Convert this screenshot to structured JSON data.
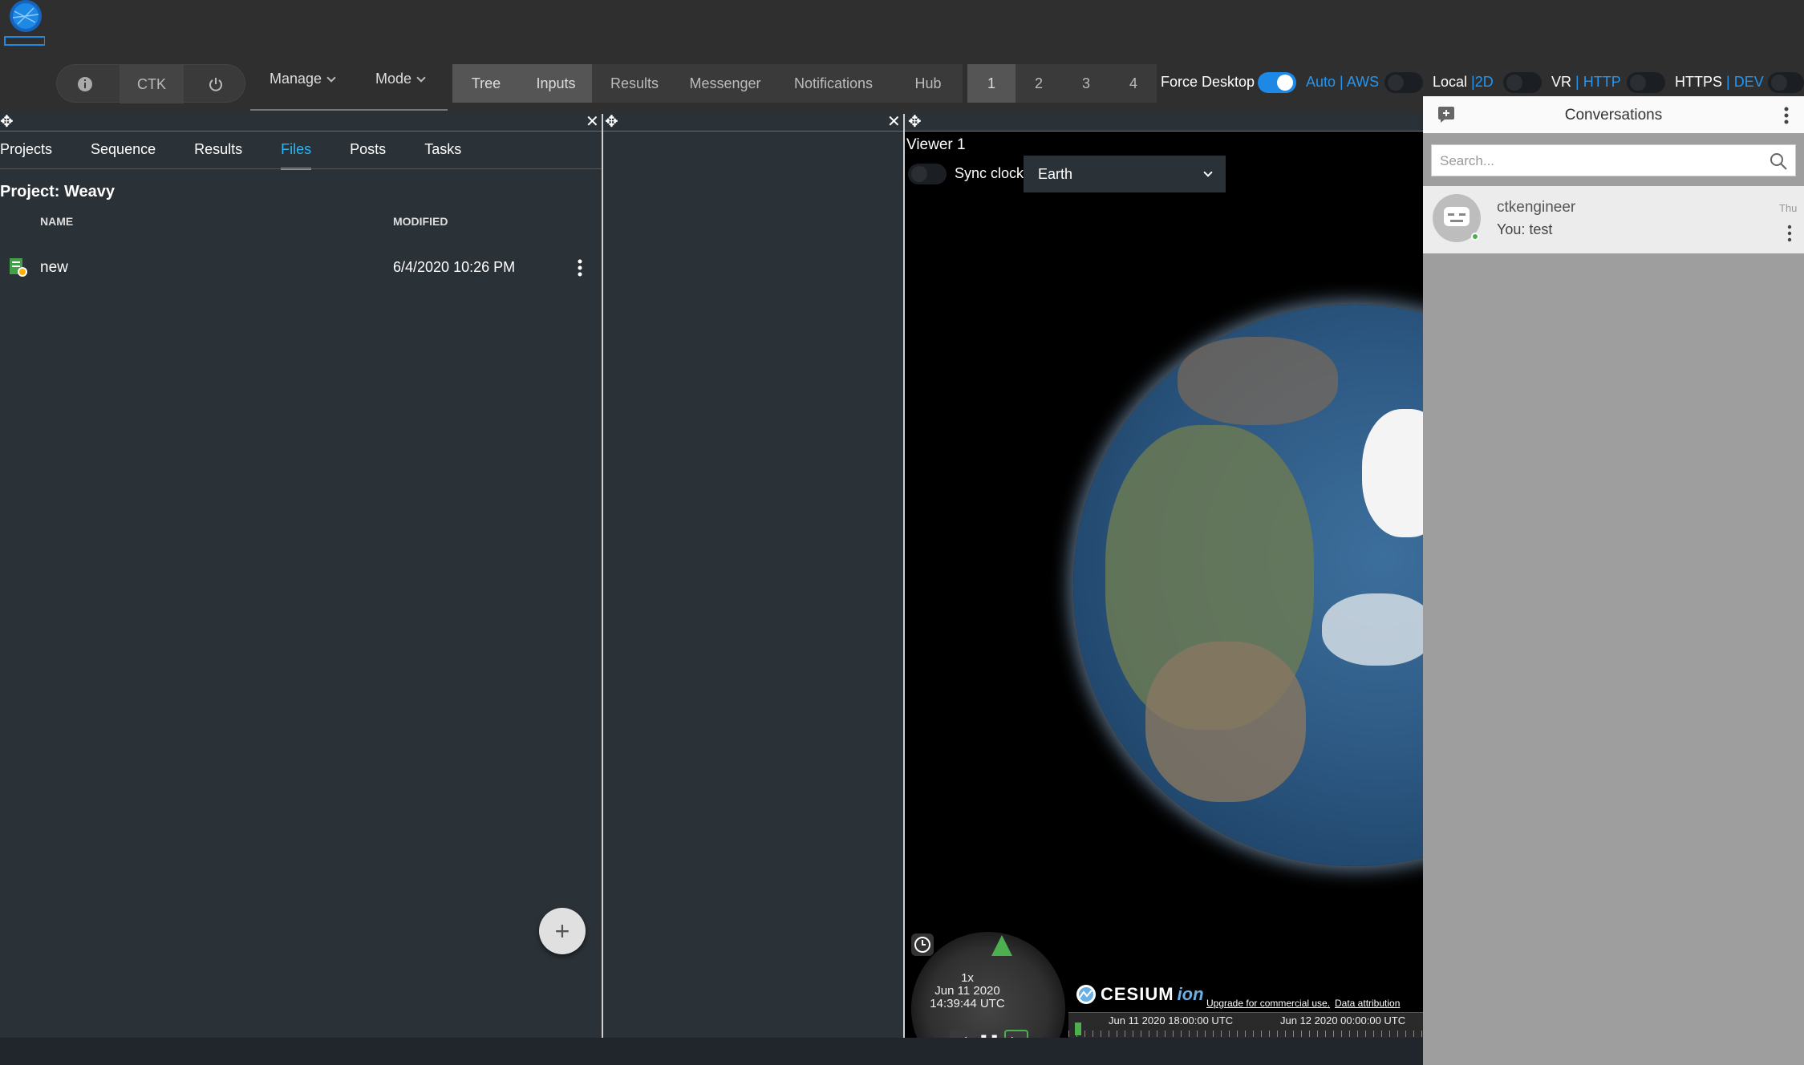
{
  "header": {
    "pill": {
      "info_icon": "info-icon",
      "label": "CTK",
      "power_icon": "power-icon"
    },
    "menus": [
      {
        "label": "Manage"
      },
      {
        "label": "Mode"
      }
    ],
    "nav_tabs": [
      "Tree",
      "Inputs",
      "Results",
      "Messenger",
      "Notifications",
      "Hub"
    ],
    "selected_nav_tabs": [
      "Tree",
      "Inputs"
    ],
    "layout_tabs": [
      "1",
      "2",
      "3",
      "4"
    ],
    "selected_layout_tab": "1",
    "toggles": {
      "force_desktop": {
        "label": "Force Desktop",
        "on": true
      },
      "auto_aws": {
        "a": "Auto",
        "sep": "|",
        "b": "AWS",
        "on": false
      },
      "local_2d": {
        "a": "Local",
        "sep": "|",
        "b": "2D",
        "on": false
      },
      "vr_http": {
        "a": "VR",
        "sep": "|",
        "b": "HTTP",
        "on": false
      },
      "https_dev": {
        "a": "HTTPS",
        "sep": "|",
        "b": "DEV",
        "on": false
      }
    }
  },
  "left_panel": {
    "tabs": [
      "Projects",
      "Sequence",
      "Results",
      "Files",
      "Posts",
      "Tasks"
    ],
    "active_tab": "Files",
    "project_title": "Project: Weavy",
    "columns": {
      "name": "NAME",
      "modified": "MODIFIED"
    },
    "files": [
      {
        "name": "new",
        "modified": "6/4/2020 10:26 PM"
      }
    ],
    "fab": "+"
  },
  "viewer": {
    "title": "Viewer 1",
    "sync_clock_label": "Sync clock",
    "sync_clock_on": false,
    "body_select": "Earth",
    "clock": {
      "speed": "1x",
      "date": "Jun 11 2020",
      "time": "14:39:44 UTC"
    },
    "brand": {
      "word": "CESIUM",
      "suffix": "ion"
    },
    "credits": [
      "Upgrade for commercial use.",
      "Data attribution"
    ],
    "timeline_labels": [
      "Jun 11 2020 18:00:00 UTC",
      "Jun 12 2020 00:00:00 UTC"
    ]
  },
  "chat": {
    "title": "Conversations",
    "search_placeholder": "Search...",
    "conversations": [
      {
        "name": "ctkengineer",
        "preview": "You: test",
        "time": "Thu"
      }
    ]
  },
  "colors": {
    "accent": "#29b6f6",
    "toggle_on": "#1e88e5",
    "panel": "#2a3137"
  }
}
